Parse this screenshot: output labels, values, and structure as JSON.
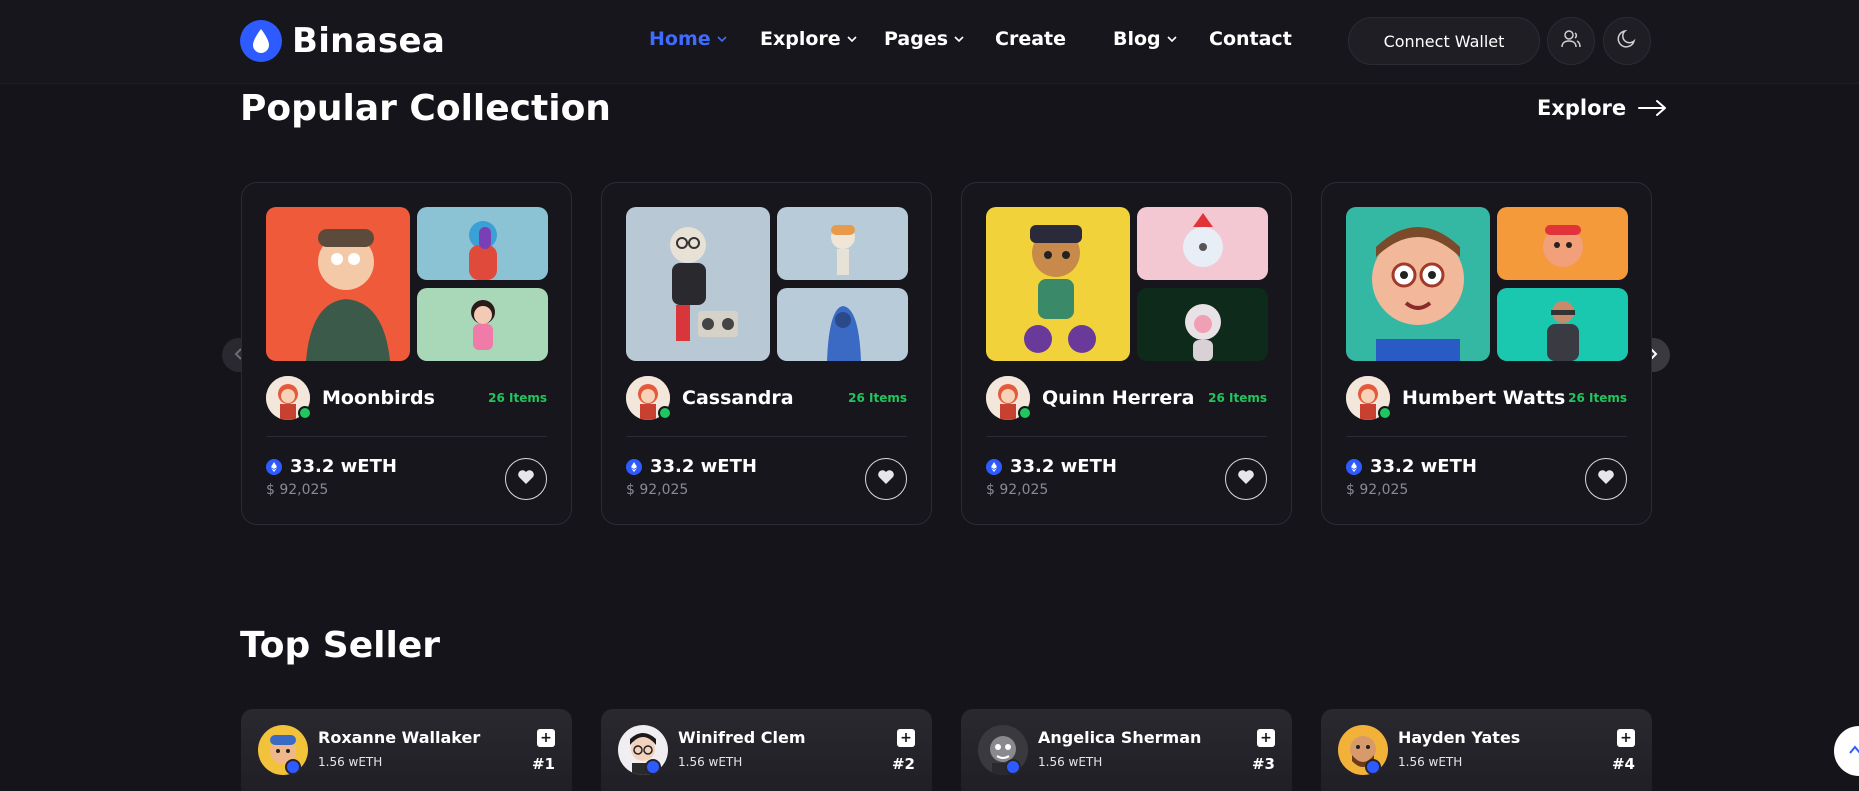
{
  "brand": {
    "name": "Binasea",
    "accent": "#2d5bff"
  },
  "nav": {
    "items": [
      {
        "label": "Home",
        "active": true,
        "dropdown": true
      },
      {
        "label": "Explore",
        "dropdown": true
      },
      {
        "label": "Pages",
        "dropdown": true
      },
      {
        "label": "Create",
        "dropdown": false
      },
      {
        "label": "Blog",
        "dropdown": true
      },
      {
        "label": "Contact",
        "dropdown": false
      }
    ],
    "connect_wallet": "Connect Wallet",
    "icons": [
      "user-icon",
      "moon-icon"
    ]
  },
  "popular": {
    "title": "Popular Collection",
    "explore_label": "Explore",
    "cards": [
      {
        "owner": "Moonbirds",
        "items": "26 Items",
        "price": "33.2 wETH",
        "usd": "$ 92,025"
      },
      {
        "owner": "Cassandra",
        "items": "26 Items",
        "price": "33.2 wETH",
        "usd": "$ 92,025"
      },
      {
        "owner": "Quinn Herrera",
        "items": "26 Items",
        "price": "33.2 wETH",
        "usd": "$ 92,025"
      },
      {
        "owner": "Humbert Watts",
        "items": "26 Items",
        "price": "33.2 wETH",
        "usd": "$ 92,025"
      }
    ]
  },
  "top_seller": {
    "title": "Top Seller",
    "sellers": [
      {
        "name": "Roxanne Wallaker",
        "amount": "1.56 wETH",
        "rank": "#1"
      },
      {
        "name": "Winifred Clem",
        "amount": "1.56 wETH",
        "rank": "#2"
      },
      {
        "name": "Angelica Sherman",
        "amount": "1.56 wETH",
        "rank": "#3"
      },
      {
        "name": "Hayden Yates",
        "amount": "1.56 wETH",
        "rank": "#4"
      }
    ]
  },
  "colors": {
    "background": "#15141a",
    "success": "#22c55e",
    "nav_active": "#3f6bff"
  }
}
